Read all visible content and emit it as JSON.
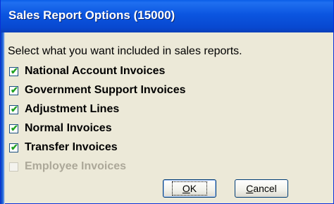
{
  "window": {
    "title": "Sales Report Options (15000)"
  },
  "prompt": "Select what you want included in sales reports.",
  "options": [
    {
      "label": "National Account Invoices",
      "checked": true,
      "enabled": true
    },
    {
      "label": "Government Support Invoices",
      "checked": true,
      "enabled": true
    },
    {
      "label": "Adjustment Lines",
      "checked": true,
      "enabled": true
    },
    {
      "label": "Normal Invoices",
      "checked": true,
      "enabled": true
    },
    {
      "label": "Transfer Invoices",
      "checked": true,
      "enabled": true
    },
    {
      "label": "Employee Invoices",
      "checked": false,
      "enabled": false
    }
  ],
  "buttons": {
    "ok": {
      "mnemonic": "O",
      "rest": "K"
    },
    "cancel": {
      "mnemonic": "C",
      "rest": "ancel"
    }
  },
  "checkmark_glyph": "✔",
  "colors": {
    "titlebar": "#0a5ee8",
    "dialog_bg": "#ece9d8",
    "checkmark": "#21a121",
    "disabled_text": "#aca899"
  }
}
